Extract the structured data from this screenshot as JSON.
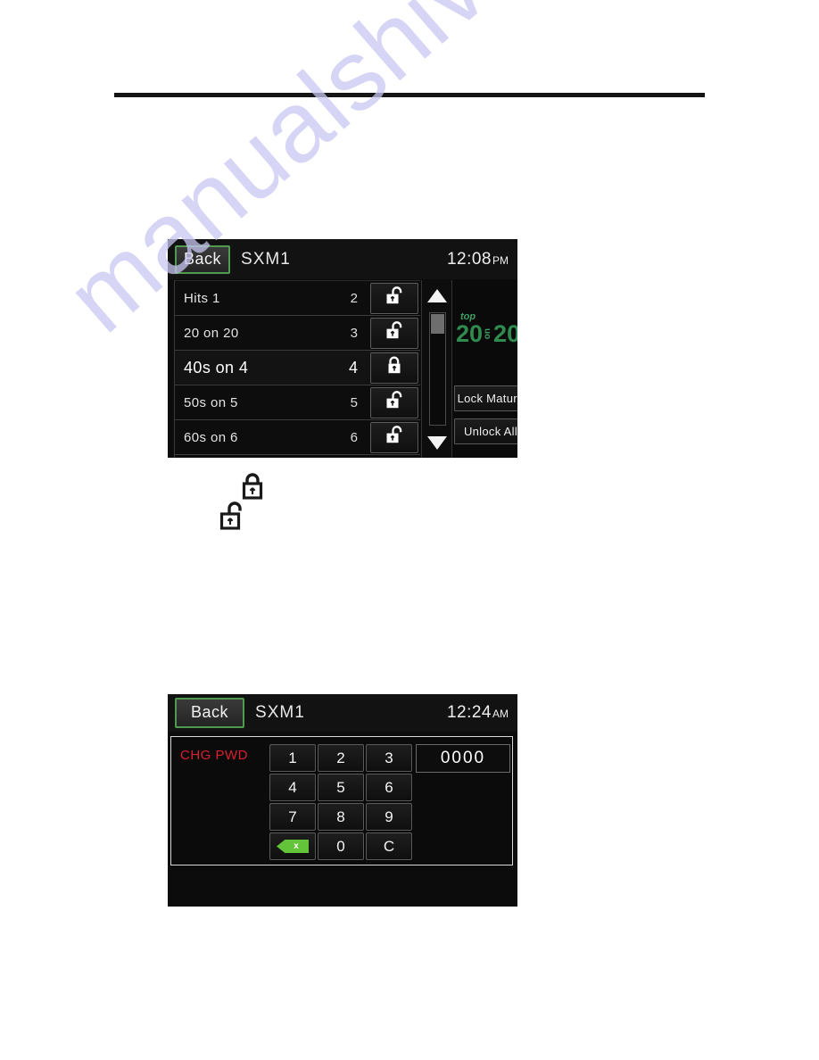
{
  "page": {
    "watermark_text": "manualshive.com",
    "rule": "horizontal-rule"
  },
  "screen_one": {
    "back_label": "Back",
    "title": "SXM1",
    "clock_time": "12:08",
    "clock_ampm": "PM",
    "scroll_up_icon": "triangle-up-icon",
    "scroll_down_icon": "triangle-down-icon",
    "logo": {
      "top": "top",
      "left_num": "20",
      "mid": "on",
      "right_num": "20",
      "color": "#2f8b4e"
    },
    "channels": [
      {
        "name": "Hits 1",
        "number": "2",
        "locked": false,
        "selected": false
      },
      {
        "name": "20 on 20",
        "number": "3",
        "locked": false,
        "selected": false
      },
      {
        "name": "40s on 4",
        "number": "4",
        "locked": true,
        "selected": true
      },
      {
        "name": "50s on 5",
        "number": "5",
        "locked": false,
        "selected": false
      },
      {
        "name": "60s on 6",
        "number": "6",
        "locked": false,
        "selected": false
      }
    ],
    "side_buttons": [
      {
        "label": "Lock Mature"
      },
      {
        "label": "Unlock All"
      }
    ]
  },
  "glyphs": {
    "locked_icon": "lock-closed-icon",
    "unlocked_icon": "lock-open-icon"
  },
  "screen_two": {
    "back_label": "Back",
    "title": "SXM1",
    "clock_time": "12:24",
    "clock_ampm": "AM",
    "mode_label": "CHG PWD",
    "mode_color": "#d92030",
    "password_value": "0000",
    "keys": [
      {
        "label": "1",
        "type": "digit"
      },
      {
        "label": "2",
        "type": "digit"
      },
      {
        "label": "3",
        "type": "digit"
      },
      {
        "label": "4",
        "type": "digit"
      },
      {
        "label": "5",
        "type": "digit"
      },
      {
        "label": "6",
        "type": "digit"
      },
      {
        "label": "7",
        "type": "digit"
      },
      {
        "label": "8",
        "type": "digit"
      },
      {
        "label": "9",
        "type": "digit"
      },
      {
        "label": "",
        "type": "backspace"
      },
      {
        "label": "0",
        "type": "digit"
      },
      {
        "label": "C",
        "type": "clear"
      }
    ],
    "backspace_glyph": "x"
  }
}
